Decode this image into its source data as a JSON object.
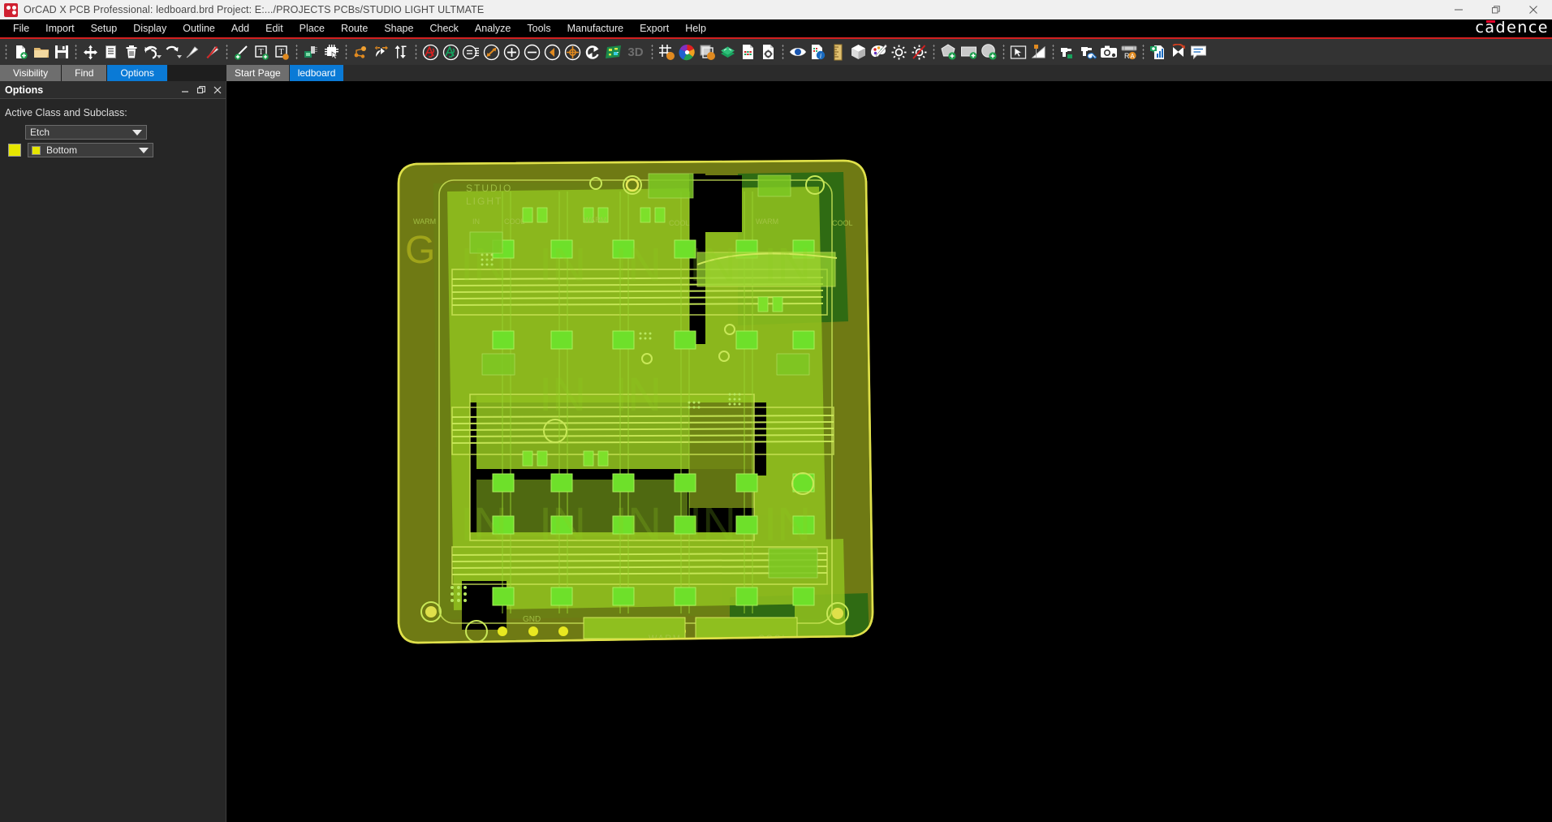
{
  "window": {
    "title": "OrCAD X PCB Professional: ledboard.brd  Project: E:.../PROJECTS PCBs/STUDIO LIGHT ULTMATE",
    "app_icon": "orcad-logo-icon",
    "controls": [
      {
        "name": "minimize-button",
        "glyph": "minimize-icon"
      },
      {
        "name": "restore-button",
        "glyph": "restore-icon"
      },
      {
        "name": "close-button",
        "glyph": "close-icon"
      }
    ],
    "brand": "cadence"
  },
  "menu": {
    "items": [
      "File",
      "Import",
      "Setup",
      "Display",
      "Outline",
      "Add",
      "Edit",
      "Place",
      "Route",
      "Shape",
      "Check",
      "Analyze",
      "Tools",
      "Manufacture",
      "Export",
      "Help"
    ]
  },
  "toolbar": {
    "groups": [
      [
        "new-file-icon",
        "open-folder-icon",
        "save-icon"
      ],
      [
        "move-icon",
        "copy-icon",
        "delete-icon",
        "undo-icon",
        "redo-icon",
        "fix-icon",
        "unfix-icon"
      ],
      [
        "add-line-icon",
        "add-text-icon",
        "add-text-block-icon"
      ],
      [
        "place-manual-icon",
        "quickplace-icon"
      ],
      [
        "logic-net-icon",
        "swap-icon",
        "inout-icon"
      ],
      [
        "unrouted-nets-icon",
        "routed-nets-icon",
        "show-element-icon",
        "measure-icon",
        "zoom-in-icon",
        "zoom-out-icon",
        "zoom-previous-icon",
        "zoom-center-icon",
        "redraw-icon",
        "board-view-icon",
        "view-3d-label"
      ],
      [
        "grid-toggle-icon",
        "color-palette-icon",
        "copy-area-icon",
        "layers-icon",
        "bom-report-icon",
        "settings-report-icon"
      ],
      [
        "visibility-eye-icon",
        "property-report-icon",
        "ruler-icon",
        "cube-icon",
        "color-paint-icon",
        "light-on-icon",
        "light-off-icon"
      ],
      [
        "shape-add-icon",
        "rect-add-icon",
        "circle-add-icon"
      ],
      [
        "select-shape-icon",
        "shape-edit-icon"
      ],
      [
        "drill-icon",
        "drill-tool-icon",
        "photo-icon",
        "rotate-ref-icon"
      ],
      [
        "chart-report-icon",
        "flip-design-icon",
        "comment-icon"
      ]
    ],
    "view_3d_label": "3D"
  },
  "left_tabs": {
    "items": [
      "Visibility",
      "Find",
      "Options"
    ],
    "active": "Options"
  },
  "doc_tabs": {
    "items": [
      "Start Page",
      "ledboard"
    ],
    "active": "ledboard"
  },
  "options_panel": {
    "title": "Options",
    "buttons": [
      "minimize-panel-icon",
      "float-panel-icon",
      "close-panel-icon"
    ],
    "active_class_label": "Active Class and Subclass:",
    "class_value": "Etch",
    "subclass_value": "Bottom",
    "swatch_color": "#e6e600"
  },
  "pcb": {
    "silkscreen_labels": [
      "STUDIO",
      "LIGHT",
      "WARM",
      "IN",
      "COOL",
      "WARM",
      "COOL",
      "WARM",
      "COOL",
      "IN",
      "IN",
      "IN",
      "IN",
      "IN",
      "IN",
      "IN",
      "IN",
      "IN",
      "IN",
      "IN",
      "IN",
      "WARM",
      "COOL",
      "GND"
    ],
    "colors": {
      "board_outline": "#dfe04a",
      "copper_bottom": "#8fbf1f",
      "copper_top": "#6b7f14",
      "pad_bright": "#6ee02a",
      "background": "#000000",
      "dark_green": "#2f6b13"
    }
  }
}
